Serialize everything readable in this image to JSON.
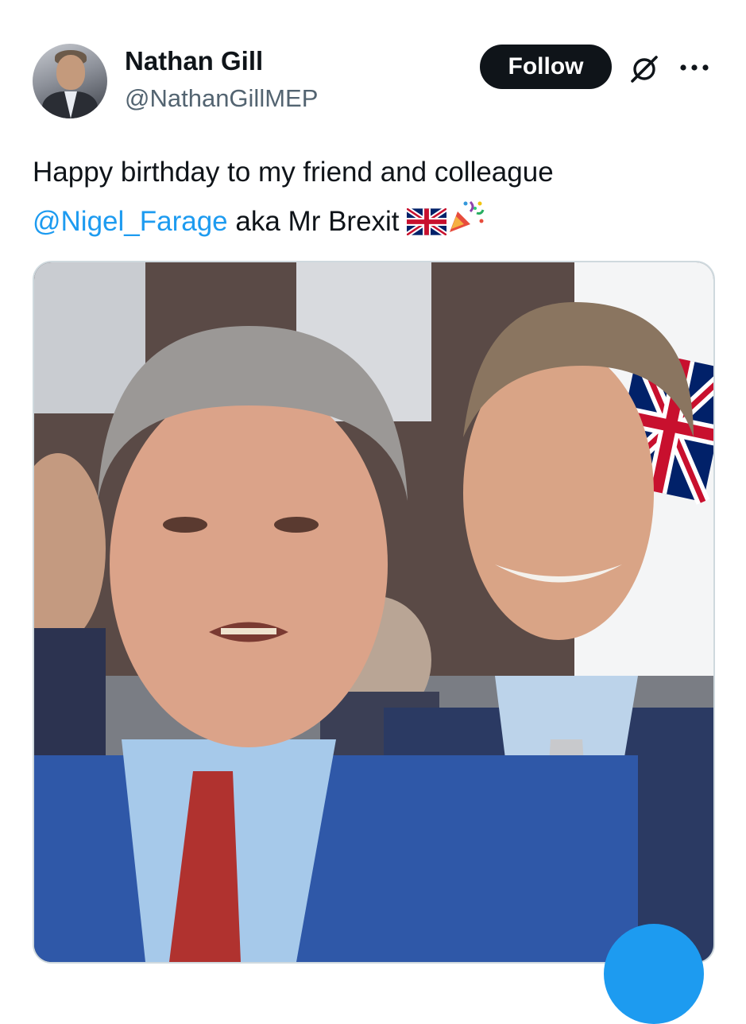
{
  "author": {
    "display_name": "Nathan Gill",
    "handle": "@NathanGillMEP"
  },
  "actions": {
    "follow_label": "Follow",
    "grok_icon": "grok-icon",
    "more_icon": "more-dots-icon"
  },
  "tweet": {
    "text_before": "Happy birthday to my friend and colleague",
    "mention": "@Nigel_Farage",
    "text_after": " aka Mr Brexit ",
    "emojis": [
      "uk-flag-icon",
      "party-popper-icon"
    ]
  },
  "media": {
    "type": "photo"
  },
  "colors": {
    "link": "#1d9bf0",
    "text": "#0f1419",
    "secondary": "#536471",
    "button": "#0f1419"
  }
}
